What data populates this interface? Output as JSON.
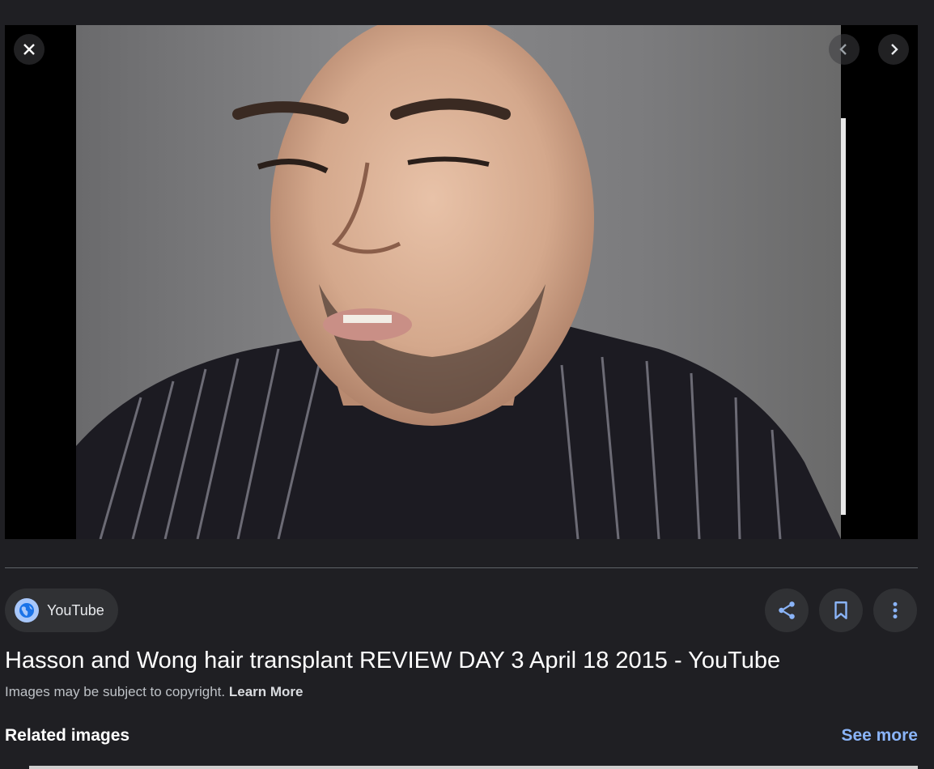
{
  "viewer": {
    "image_alt": "Man with swollen face after hair transplant",
    "close_icon": "close-icon",
    "prev_icon": "chevron-left-icon",
    "next_icon": "chevron-right-icon"
  },
  "source": {
    "label": "YouTube",
    "icon": "globe-icon"
  },
  "actions": {
    "share_icon": "share-icon",
    "save_icon": "bookmark-icon",
    "more_icon": "more-vert-icon"
  },
  "result": {
    "title": "Hasson and Wong hair transplant REVIEW DAY 3 April 18 2015 - YouTube",
    "copyright_text": "Images may be subject to copyright.",
    "learn_more": "Learn More"
  },
  "related": {
    "heading": "Related images",
    "see_more": "See more"
  },
  "colors": {
    "background": "#1f1f23",
    "accent": "#8ab4f8",
    "chip": "#303134"
  }
}
